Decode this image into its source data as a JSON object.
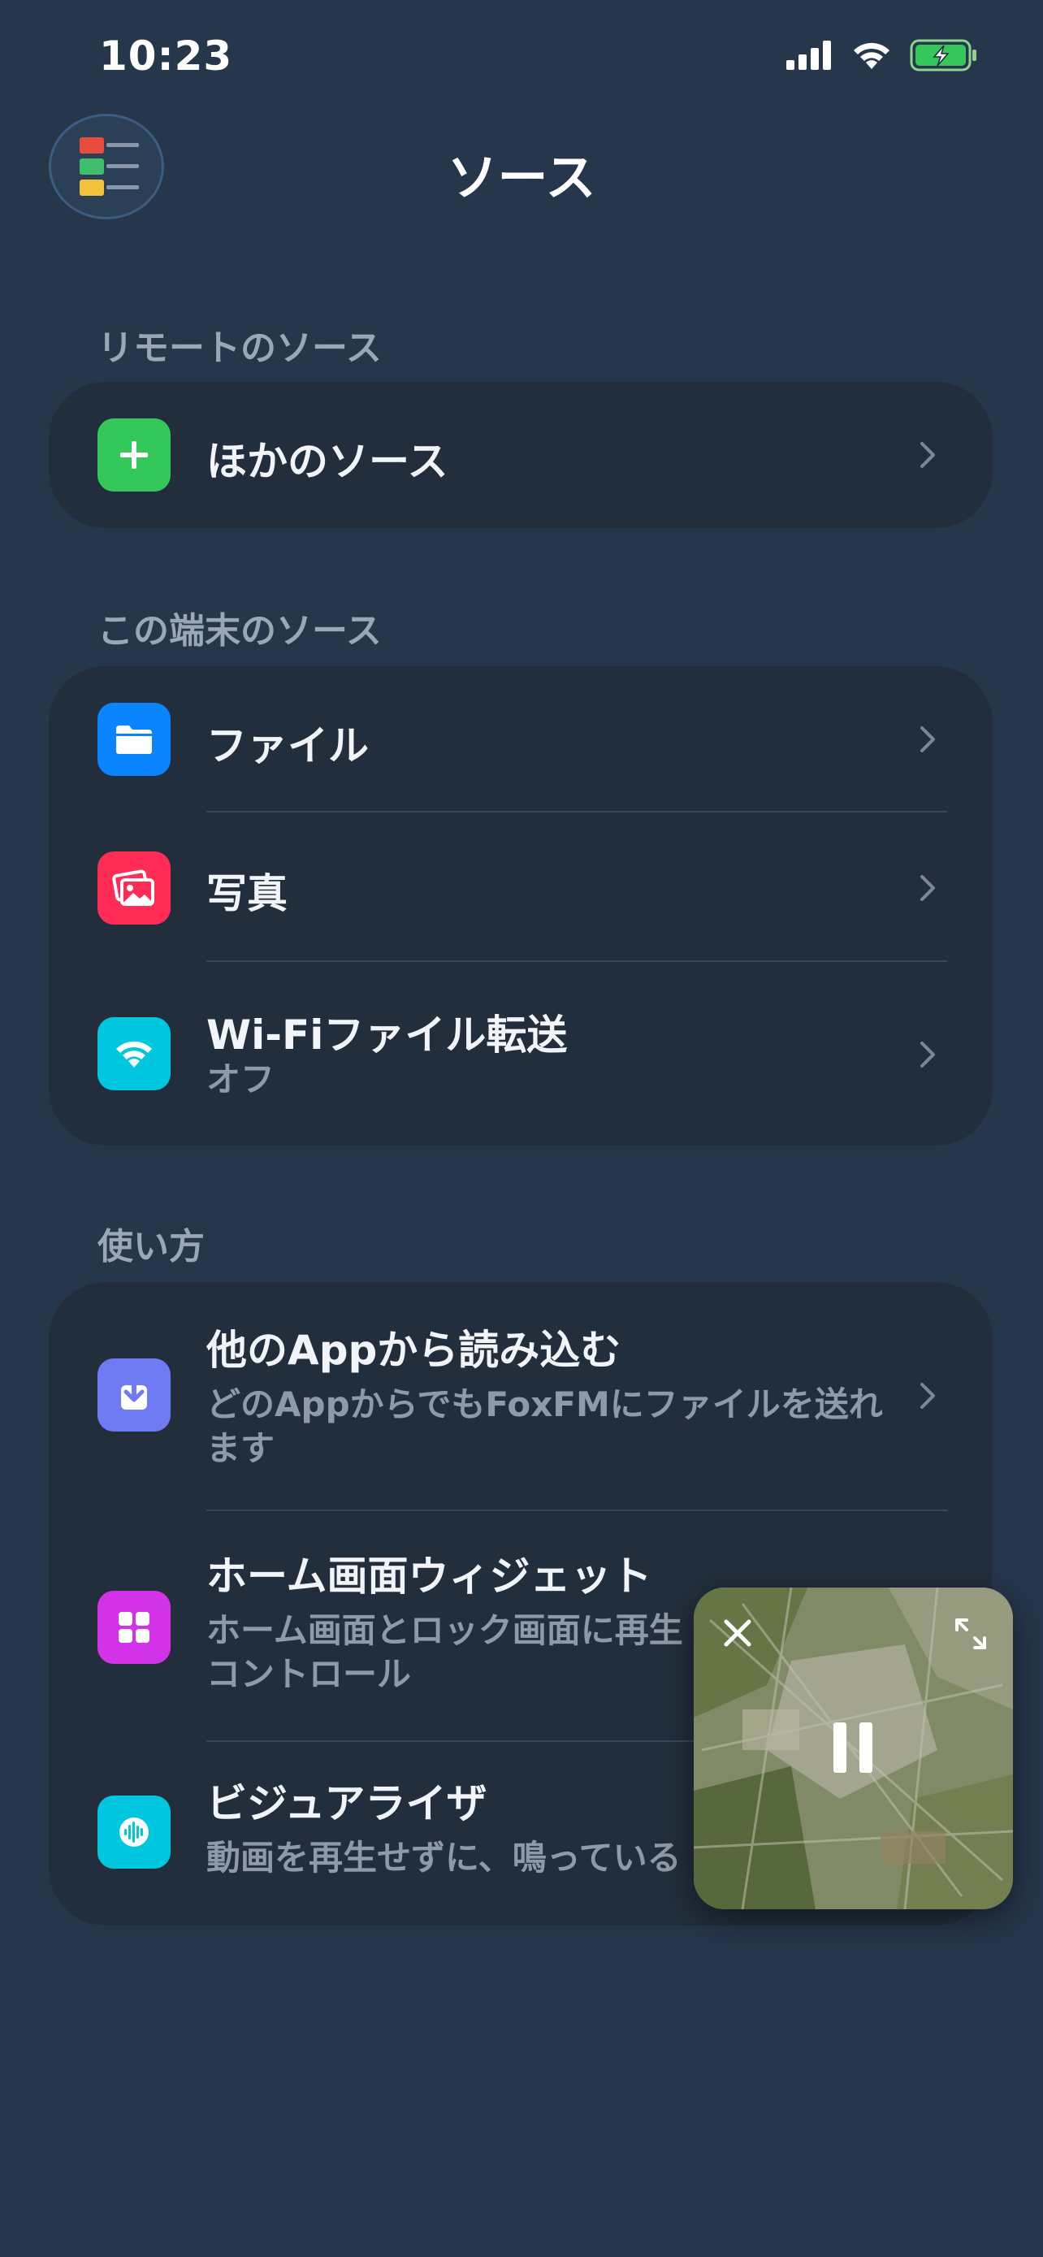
{
  "status_bar": {
    "time": "10:23"
  },
  "header": {
    "title": "ソース"
  },
  "sections": {
    "remote": {
      "label": "リモートのソース",
      "items": [
        {
          "title": "ほかのソース",
          "icon": "plus-icon",
          "color": "#34c759"
        }
      ]
    },
    "device": {
      "label": "この端末のソース",
      "items": [
        {
          "title": "ファイル",
          "icon": "folder-icon",
          "color": "#0a84ff"
        },
        {
          "title": "写真",
          "icon": "photos-icon",
          "color": "#ff2d55"
        },
        {
          "title": "Wi-Fiファイル転送",
          "subtitle": "オフ",
          "icon": "wifi-icon",
          "color": "#00c7e0"
        }
      ]
    },
    "howto": {
      "label": "使い方",
      "items": [
        {
          "title": "他のAppから読み込む",
          "subtitle_line1": "どのAppからでもFoxFMにファイルを送れ",
          "subtitle_line2": "ます",
          "icon": "import-icon",
          "color": "#6e7bf2"
        },
        {
          "title": "ホーム画面ウィジェット",
          "subtitle_line1": "ホーム画面とロック画面に再生",
          "subtitle_line2": "コントロール",
          "icon": "widget-grid-icon",
          "color": "#d233e8"
        },
        {
          "title": "ビジュアライザ",
          "subtitle_line1": "動画を再生せずに、鳴っている",
          "icon": "waveform-icon",
          "color": "#00c7e0"
        }
      ]
    }
  },
  "pip_player": {
    "state": "playing",
    "controls": [
      "close-icon",
      "expand-icon",
      "pause-icon"
    ]
  }
}
